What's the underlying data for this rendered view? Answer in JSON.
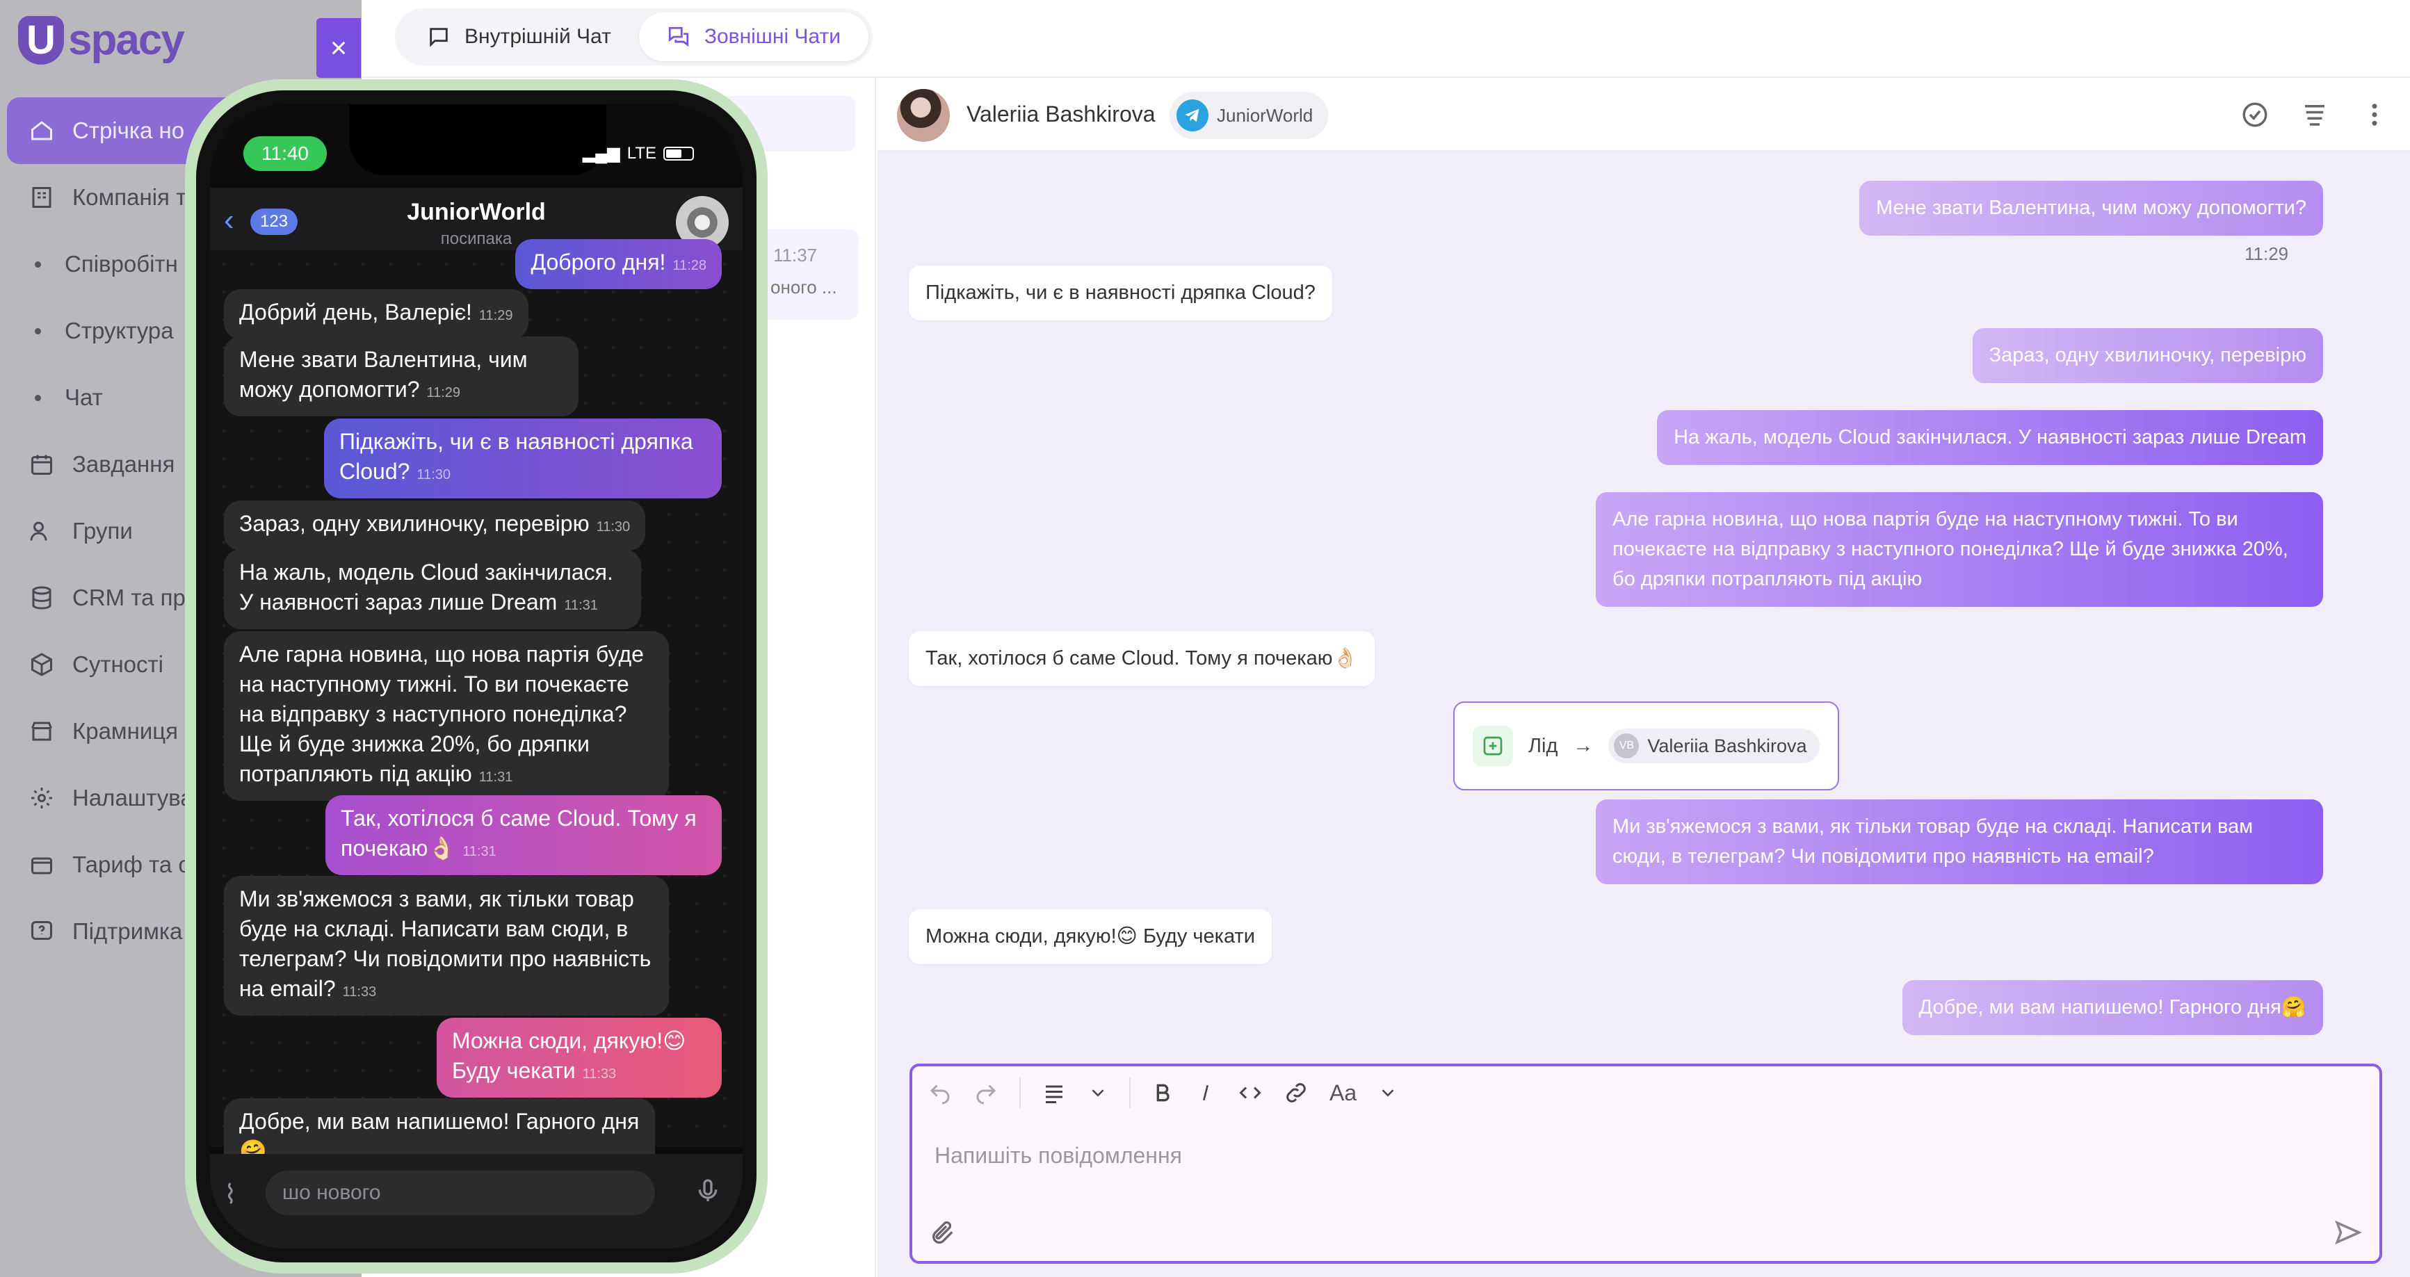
{
  "app": {
    "logo": "spacy",
    "logo_letter": "U"
  },
  "sidebar": {
    "items": [
      {
        "label": "Стрічка но",
        "icon": "home-icon",
        "active": true
      },
      {
        "label": "Компанія т",
        "icon": "building-icon"
      },
      {
        "label": "Співробітн",
        "sub": true
      },
      {
        "label": "Структура",
        "sub": true
      },
      {
        "label": "Чат",
        "sub": true
      },
      {
        "label": "Завдання",
        "icon": "calendar-icon"
      },
      {
        "label": "Групи",
        "icon": "users-icon"
      },
      {
        "label": "CRM та пр",
        "icon": "database-icon"
      },
      {
        "label": "Сутності",
        "icon": "cube-icon"
      },
      {
        "label": "Крамниця",
        "icon": "shop-icon"
      },
      {
        "label": "Налаштува",
        "icon": "gear-icon"
      },
      {
        "label": "Тариф та о",
        "icon": "wallet-icon"
      },
      {
        "label": "Підтримка",
        "icon": "help-icon"
      }
    ]
  },
  "tabs": {
    "internal": "Внутрішній Чат",
    "external": "Зовнішні Чати"
  },
  "close_label": "×",
  "midlist": {
    "time": "11:37",
    "snippet": "оного ..."
  },
  "chat": {
    "contact": "Valeriia Bashkirova",
    "channel": "JuniorWorld",
    "messages": [
      {
        "dir": "out",
        "text": "Мене звати Валентина, чим можу допомогти?",
        "time": "11:29"
      },
      {
        "dir": "in",
        "text": "Підкажіть, чи є в наявності дряпка Cloud?"
      },
      {
        "dir": "out",
        "text": "Зараз, одну хвилиночку, перевірю"
      },
      {
        "dir": "out",
        "text": "На жаль, модель Cloud закінчилася. У наявності зараз лише Dream"
      },
      {
        "dir": "out",
        "text": "Але гарна новина, що нова партія буде на наступному тижні. То ви почекаєте на відправку з наступного понеділка? Ще й буде знижка 20%, бо дряпки потрапляють під акцію"
      },
      {
        "dir": "in",
        "text": "Так, хотілося б саме Cloud. Тому я почекаю👌🏻"
      },
      {
        "dir": "out",
        "text": "Ми зв'яжемося з вами, як тільки товар буде на складі. Написати вам сюди, в телеграм? Чи повідомити про наявність на email?"
      },
      {
        "dir": "in",
        "text": "Можна сюди, дякую!😊 Буду чекати"
      },
      {
        "dir": "out",
        "text": "Добре, ми вам напишемо! Гарного дня🤗"
      }
    ],
    "lead": {
      "label": "Лід",
      "arrow": "→",
      "initials": "VB",
      "name": "Valeriia Bashkirova"
    }
  },
  "composer": {
    "placeholder": "Напишіть повідомлення",
    "font_label": "Aa"
  },
  "phone": {
    "time": "11:40",
    "network": "LTE",
    "title": "JuniorWorld",
    "subtitle": "посипака",
    "back_count": "123",
    "input_placeholder": "шо нового",
    "messages": [
      {
        "dir": "out",
        "text": "Доброго дня!",
        "time": "11:28"
      },
      {
        "dir": "in",
        "text": "Добрий день, Валеріє!",
        "time": "11:29"
      },
      {
        "dir": "in",
        "text": "Мене звати Валентина, чим можу допомогти?",
        "time": "11:29"
      },
      {
        "dir": "out",
        "text": "Підкажіть, чи є в наявності дряпка Cloud?",
        "time": "11:30"
      },
      {
        "dir": "in",
        "text": "Зараз, одну хвилиночку, перевірю",
        "time": "11:30"
      },
      {
        "dir": "in",
        "text": "На жаль, модель Cloud закінчилася. У наявності зараз лише Dream",
        "time": "11:31"
      },
      {
        "dir": "in",
        "text": "Але гарна новина, що нова партія буде на наступному тижні. То ви почекаєте на відправку з наступного понеділка? Ще й буде знижка 20%, бо дряпки потрапляють під акцію",
        "time": "11:31"
      },
      {
        "dir": "out",
        "text": "Так, хотілося б саме Cloud. Тому я почекаю👌🏻",
        "time": "11:31"
      },
      {
        "dir": "in",
        "text": "Ми зв'яжемося з вами, як тільки товар буде на складі. Написати вам сюди, в телеграм? Чи повідомити про наявність на email?",
        "time": "11:33"
      },
      {
        "dir": "out",
        "text": "Можна сюди, дякую!😊 Буду чекати",
        "time": "11:33"
      },
      {
        "dir": "in",
        "text": "Добре, ми вам напишемо! Гарного дня 🤗",
        "time": ""
      }
    ]
  }
}
